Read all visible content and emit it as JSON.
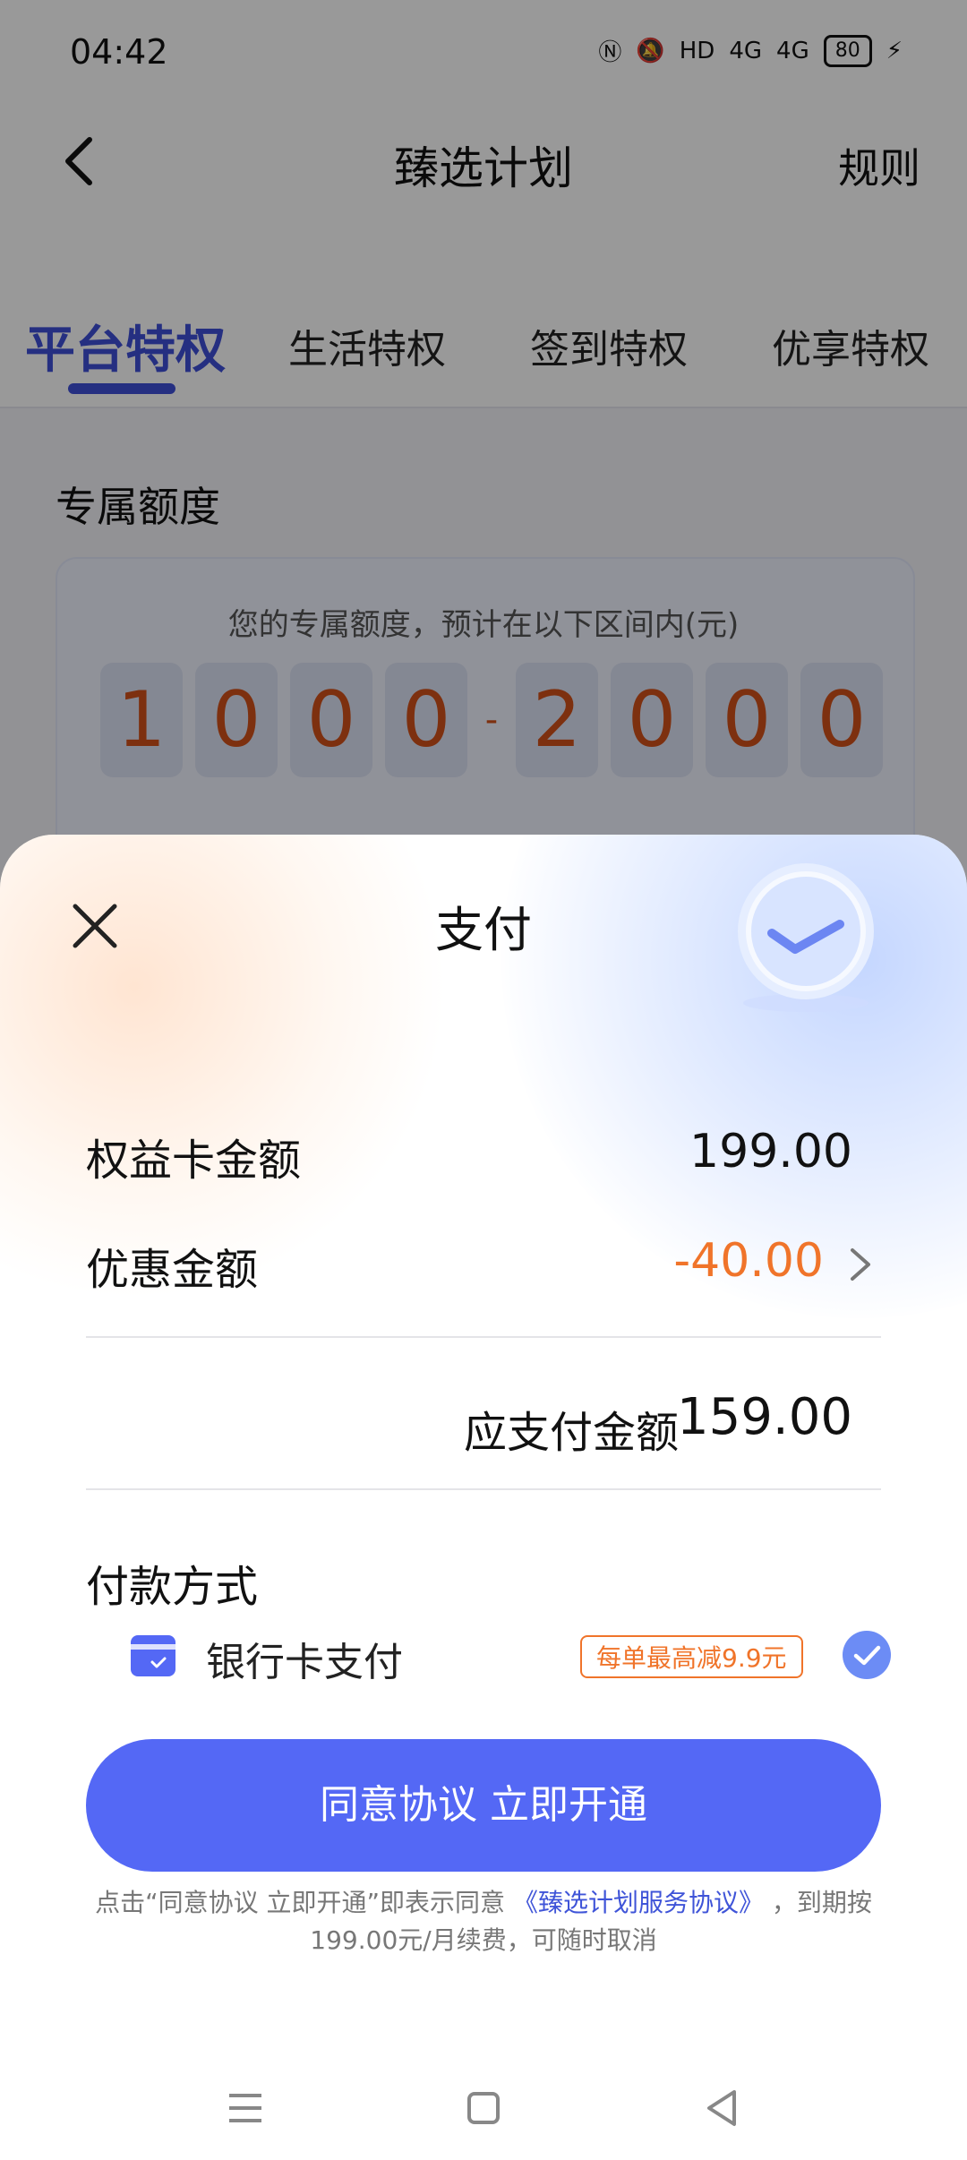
{
  "status": {
    "time": "04:42",
    "battery": "80",
    "signal1": "4G",
    "signal2": "4G",
    "hd": "HD"
  },
  "header": {
    "title": "臻选计划",
    "rules": "规则"
  },
  "tabs": [
    {
      "label": "平台特权",
      "active": true
    },
    {
      "label": "生活特权"
    },
    {
      "label": "签到特权"
    },
    {
      "label": "优享特权"
    }
  ],
  "quota": {
    "section_title": "专属额度",
    "subtitle": "您的专属额度，预计在以下区间内(元)",
    "digits": [
      "1",
      "0",
      "0",
      "0",
      "-",
      "2",
      "0",
      "0",
      "0"
    ]
  },
  "sheet": {
    "title": "支付",
    "card_amount_label": "权益卡金额",
    "card_amount_value": "199.00",
    "discount_label": "优惠金额",
    "discount_value": "-40.00",
    "payable_label": "应支付金额",
    "payable_value": "159.00",
    "payment_method_title": "付款方式",
    "payment_option": "银行卡支付",
    "promo_badge": "每单最高减9.9元",
    "cta_label": "同意协议 立即开通",
    "notice_prefix": "点击“同意协议 立即开通”即表示同意",
    "notice_link": "《臻选计划服务协议》",
    "notice_suffix": "，到期按199.00元/月续费，可随时取消"
  },
  "colors": {
    "accent": "#5468f5",
    "discount": "#f0742a",
    "digit": "#d0501a"
  }
}
